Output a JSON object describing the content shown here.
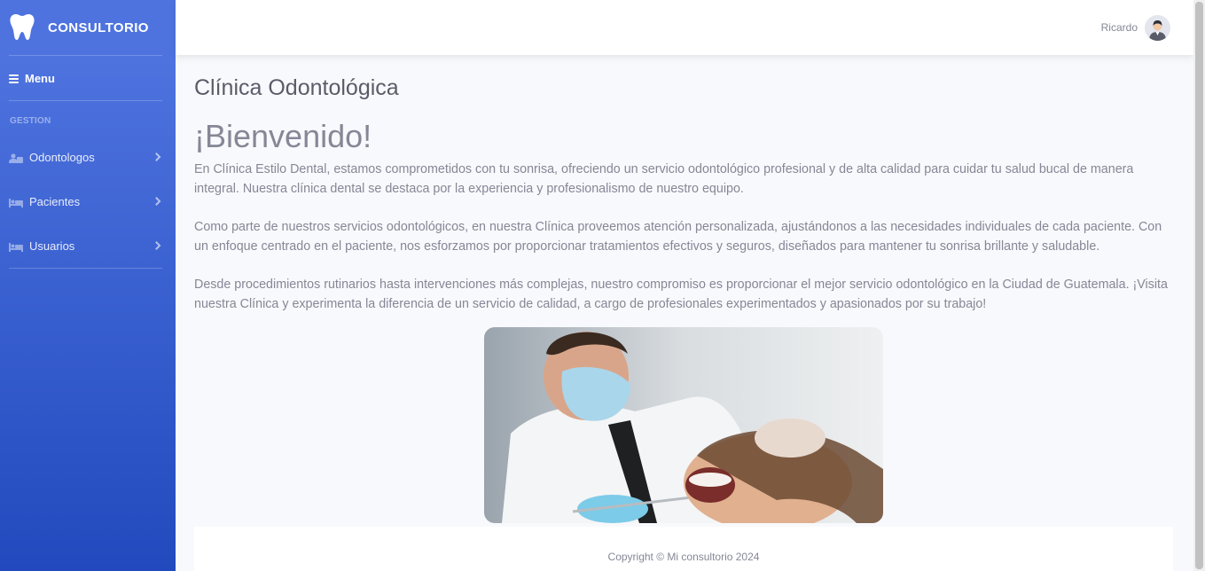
{
  "brand": {
    "name": "CONSULTORIO",
    "icon": "tooth-icon"
  },
  "sidebar": {
    "menu_label": "Menu",
    "section_label": "GESTION",
    "items": [
      {
        "label": "Odontologos",
        "icon": "user-tie-icon"
      },
      {
        "label": "Pacientes",
        "icon": "bed-icon"
      },
      {
        "label": "Usuarios",
        "icon": "bed-icon"
      }
    ]
  },
  "topbar": {
    "username": "Ricardo",
    "avatar": "avatar-icon"
  },
  "main": {
    "title": "Clínica Odontológica",
    "welcome": "¡Bienvenido!",
    "paragraphs": [
      "En Clínica Estilo Dental, estamos comprometidos con tu sonrisa, ofreciendo un servicio odontológico profesional y de alta calidad para cuidar tu salud bucal de manera integral. Nuestra clínica dental se destaca por la experiencia y profesionalismo de nuestro equipo.",
      "Como parte de nuestros servicios odontológicos, en nuestra Clínica proveemos atención personalizada, ajustándonos a las necesidades individuales de cada paciente. Con un enfoque centrado en el paciente, nos esforzamos por proporcionar tratamientos efectivos y seguros, diseñados para mantener tu sonrisa brillante y saludable.",
      "Desde procedimientos rutinarios hasta intervenciones más complejas, nuestro compromiso es proporcionar el mejor servicio odontológico en la Ciudad de Guatemala. ¡Visita nuestra Clínica y experimenta la diferencia de un servicio de calidad, a cargo de profesionales experimentados y apasionados por su trabajo!"
    ]
  },
  "footer": {
    "copyright": "Copyright © Mi consultorio 2024"
  },
  "colors": {
    "sidebar_top": "#4e73df",
    "sidebar_bottom": "#224abe",
    "page_bg": "#f8f9fc",
    "text": "#858796",
    "title": "#5a5c69"
  }
}
